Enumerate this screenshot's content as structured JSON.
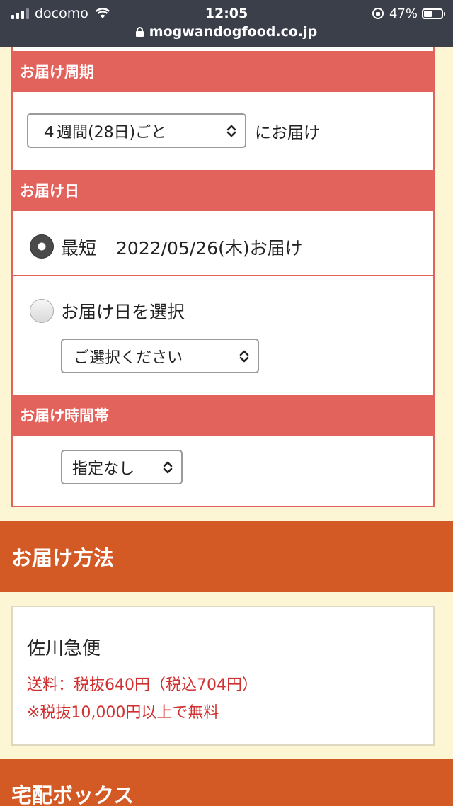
{
  "status_bar": {
    "carrier": "docomo",
    "time": "12:05",
    "battery": "47%",
    "battery_level": 0.47,
    "url": "mogwandogfood.co.jp"
  },
  "delivery_cycle": {
    "header": "お届け周期",
    "select_value": "４週間(28日)ごと",
    "suffix": "にお届け"
  },
  "delivery_date": {
    "header": "お届け日",
    "option_earliest_label": "最短",
    "earliest_date": "2022/05/26(木)お届け",
    "option_select_label": "お届け日を選択",
    "select_placeholder": "ご選択ください",
    "selected": "earliest"
  },
  "delivery_time": {
    "header": "お届け時間帯",
    "select_value": "指定なし"
  },
  "delivery_method": {
    "band": "お届け方法",
    "carrier_name": "佐川急便",
    "fee": "送料：税抜640円（税込704円）",
    "free_note": "※税抜10,000円以上で無料"
  },
  "next_section": {
    "band": "宅配ボックス"
  },
  "colors": {
    "section_header": "#e2635c",
    "band": "#d45a25",
    "fee_text": "#d03030",
    "page_bg": "#fdf6d4"
  }
}
